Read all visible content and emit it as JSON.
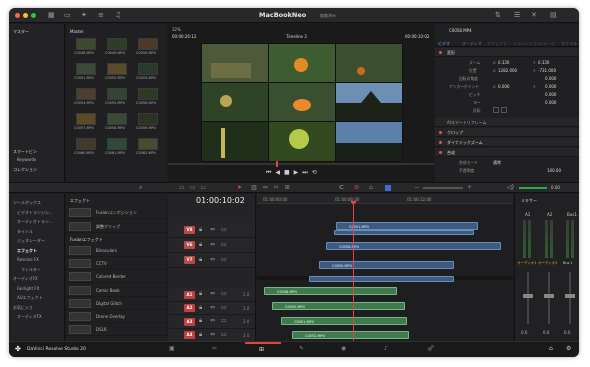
{
  "window": {
    "title": "MacBookNeo",
    "subtitle": "編集済み"
  },
  "toolbar": {
    "zoom": "32%",
    "timecode_left": "00:00:26:12",
    "timeline_name": "Timeline 3",
    "timecode_right": "00:00:10:02",
    "clip_name": "C0058.MP4"
  },
  "media_pool": {
    "master_label": "マスター",
    "bin_title": "Master",
    "thumbs": [
      "C0048.MP4",
      "C0049.MP4",
      "C0050.MP4",
      "C0051.MP4",
      "C0052.MP4",
      "C0053.MP4",
      "C0054.MP4",
      "C0055.MP4",
      "C0056.MP4",
      "C0057.MP4",
      "C0058.MP4",
      "C0059.MP4",
      "C0060.MP4",
      "C0061.MP4",
      "C0062.MP4"
    ],
    "smart_bins": "スマートビン",
    "keywords": "Keywords",
    "collections": "コレクション"
  },
  "effects": {
    "tree": [
      "ツールボックス",
      "ビデオトランジシ...",
      "オーディオトラン...",
      "タイトル",
      "ジェネレーター",
      "エフェクト",
      "Resolve FX",
      "フィルター",
      "オーディオFX",
      "Fairlight FX",
      "AUエフェクト",
      "お気に入り",
      "オーディオFX"
    ],
    "header": "エフェクト",
    "fusion_header": "Fusionエフェクト",
    "items_top": [
      "Fusionコンポジション",
      "調整クリップ"
    ],
    "items": [
      "Binoculars",
      "CCTV",
      "Colored Border",
      "Comic Book",
      "Digital Glitch",
      "Drone Overlay",
      "DSLR"
    ]
  },
  "timeline": {
    "timecode": "01:00:10:02",
    "ruler": [
      "01:00:00:00",
      "01:00:06:00",
      "01:00:12:00"
    ],
    "video_tracks": [
      "V8",
      "V6",
      "V7"
    ],
    "audio_tracks": [
      "A1",
      "A2",
      "A3",
      "A4",
      "A5"
    ],
    "audio_level": "2.0",
    "video_clips": [
      "C0051.MP4",
      "C0056.MP4",
      "C0050.MP4"
    ],
    "audio_clips": [
      "C0048.MP4",
      "C0050.MP4",
      "C0051.MP4",
      "C0052.MP4"
    ]
  },
  "mixer": {
    "title": "ミキサー",
    "channels": [
      "A1",
      "A2",
      "Bus1"
    ],
    "sub": [
      "オーディオ1",
      "オーディオ2",
      "Bus 1"
    ],
    "level": "-0.0",
    "db": "0.0"
  },
  "inspector": {
    "tabs": [
      "ビデオ",
      "オーディオ",
      "エフェクト",
      "トランジション",
      "イメージ",
      "ファイル"
    ],
    "transform": "変形",
    "zoom_label": "ズーム",
    "zoom_x": "0.330",
    "zoom_y": "0.330",
    "position_label": "位置",
    "pos_x": "1282.000",
    "pos_y": "-731.000",
    "rotation_label": "回転の角度",
    "rotation": "0.000",
    "anchor_label": "アンカーポイント",
    "anchor_x": "0.000",
    "anchor_y": "0.000",
    "pitch_label": "ピッチ",
    "pitch": "0.000",
    "yaw_label": "ヨー",
    "yaw": "0.000",
    "flip_label": "反転",
    "smart_reframe": "AIスマートリフレーム",
    "crop": "クロップ",
    "dynamic_zoom": "ダイナミックズーム",
    "composite": "合成",
    "composite_mode_label": "合成モード",
    "composite_mode": "通常",
    "opacity_label": "不透明度",
    "opacity": "100.00"
  },
  "volume": {
    "value": "0.00"
  },
  "footer": {
    "app": "DaVinci Resolve Studio 20"
  }
}
